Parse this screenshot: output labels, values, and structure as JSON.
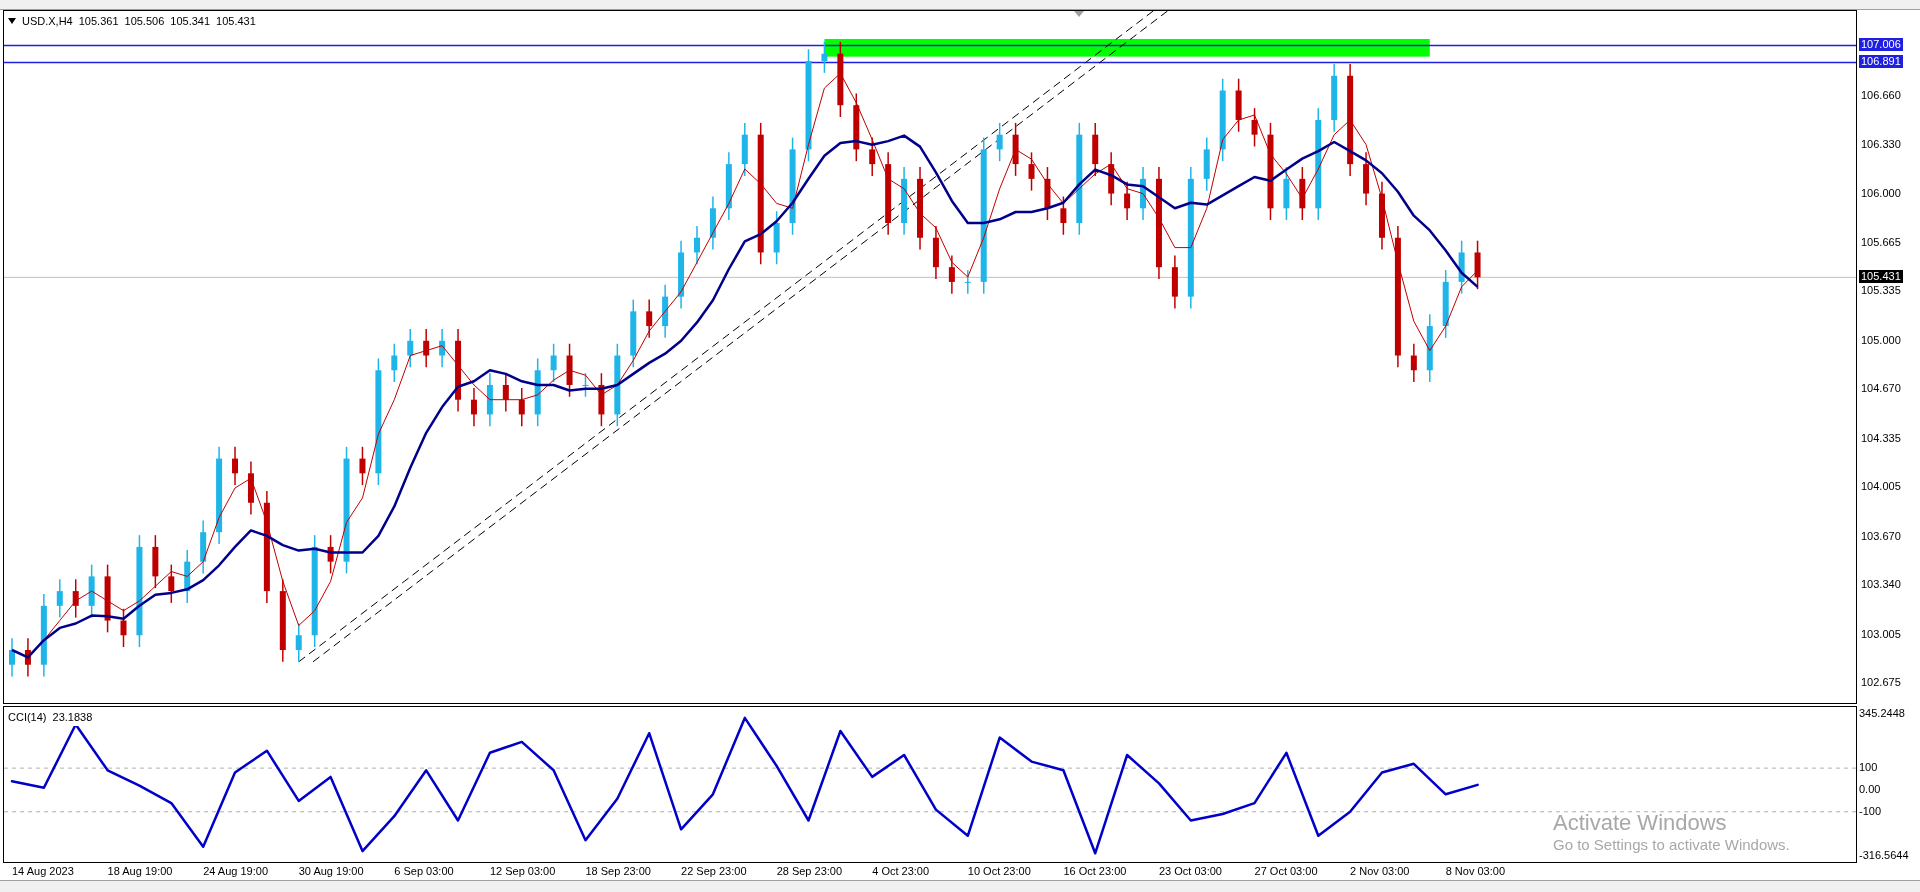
{
  "chart": {
    "symbol": "USD.X,H4",
    "ohlc": [
      "105.361",
      "105.506",
      "105.341",
      "105.431"
    ],
    "price_axis": [
      {
        "label": "107.006",
        "kind": "level"
      },
      {
        "label": "106.891",
        "kind": "level"
      },
      {
        "label": "106.660",
        "kind": "tick"
      },
      {
        "label": "106.330",
        "kind": "tick"
      },
      {
        "label": "106.000",
        "kind": "tick"
      },
      {
        "label": "105.665",
        "kind": "tick"
      },
      {
        "label": "105.431",
        "kind": "bid"
      },
      {
        "label": "105.335",
        "kind": "tick"
      },
      {
        "label": "105.000",
        "kind": "tick"
      },
      {
        "label": "104.670",
        "kind": "tick"
      },
      {
        "label": "104.335",
        "kind": "tick"
      },
      {
        "label": "104.005",
        "kind": "tick"
      },
      {
        "label": "103.670",
        "kind": "tick"
      },
      {
        "label": "103.340",
        "kind": "tick"
      },
      {
        "label": "103.005",
        "kind": "tick"
      },
      {
        "label": "102.675",
        "kind": "tick"
      }
    ],
    "date_axis": [
      "14 Aug 2023",
      "18 Aug 19:00",
      "24 Aug 19:00",
      "30 Aug 19:00",
      "6 Sep 03:00",
      "12 Sep 03:00",
      "18 Sep 23:00",
      "22 Sep 23:00",
      "28 Sep 23:00",
      "4 Oct 23:00",
      "10 Oct 23:00",
      "16 Oct 23:00",
      "23 Oct 03:00",
      "27 Oct 03:00",
      "2 Nov 03:00",
      "8 Nov 03:00"
    ]
  },
  "cci": {
    "label": "CCI(14)",
    "value": "23.1838",
    "max_label": "345.2448",
    "min_label": "-316.5644",
    "chart_data": {
      "type": "line",
      "ylim": [
        -330,
        380
      ],
      "yticks": [
        {
          "value": 100,
          "label": "100"
        },
        {
          "value": 0,
          "label": "0.00"
        },
        {
          "value": -100,
          "label": "-100"
        }
      ],
      "series": [
        {
          "color": "#0000c8",
          "values": [
            40,
            10,
            300,
            90,
            20,
            -60,
            -260,
            80,
            180,
            -50,
            60,
            -280,
            -120,
            90,
            -140,
            170,
            220,
            90,
            -230,
            -40,
            260,
            -180,
            -20,
            330,
            110,
            -140,
            270,
            60,
            160,
            -90,
            -210,
            240,
            130,
            90,
            -290,
            160,
            30,
            -140,
            -110,
            -60,
            170,
            -210,
            -100,
            80,
            120,
            -20,
            23
          ]
        }
      ]
    }
  },
  "os_overlay": {
    "title": "Activate Windows",
    "subtitle": "Go to Settings to activate Windows."
  }
}
